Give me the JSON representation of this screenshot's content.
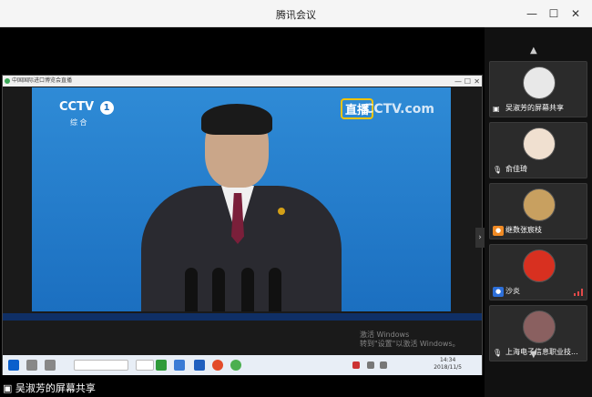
{
  "window": {
    "title": "腾讯会议",
    "minimize_icon": "—",
    "maximize_icon": "☐",
    "close_icon": "✕"
  },
  "shared_screen": {
    "title": "中国国际进口博览会直播",
    "video": {
      "channel_logo": "CCTV",
      "channel_number": "1",
      "channel_sub": "综 合",
      "live_label": "直播",
      "site_logo": "CCTV.com"
    },
    "watermark_line1": "激活 Windows",
    "watermark_line2": "转到\"设置\"以激活 Windows。",
    "taskbar_time": "14:34",
    "taskbar_date": "2018/11/5"
  },
  "sharer_label": "吴淑芳的屏幕共享",
  "participants": [
    {
      "name": "吴淑芳的屏幕共享",
      "avatar_color": "#e8e8e8",
      "status": "mic-muted"
    },
    {
      "name": "俞佳琦",
      "avatar_color": "#f0e0d0",
      "status": "mic-muted"
    },
    {
      "name": "继数张宸枝",
      "avatar_color": "#c8a060",
      "status": "mic-muted"
    },
    {
      "name": "沙炎",
      "avatar_color": "#d83020",
      "status": "mic-muted"
    },
    {
      "name": "上海电子信息职业技...",
      "avatar_color": "#8a6060",
      "status": "mic-muted"
    }
  ],
  "colors": {
    "accent": "#1b6fc0",
    "tile_bg": "#2b2b2b",
    "badge_orange": "#f08a24",
    "badge_blue": "#2d6fd8"
  }
}
